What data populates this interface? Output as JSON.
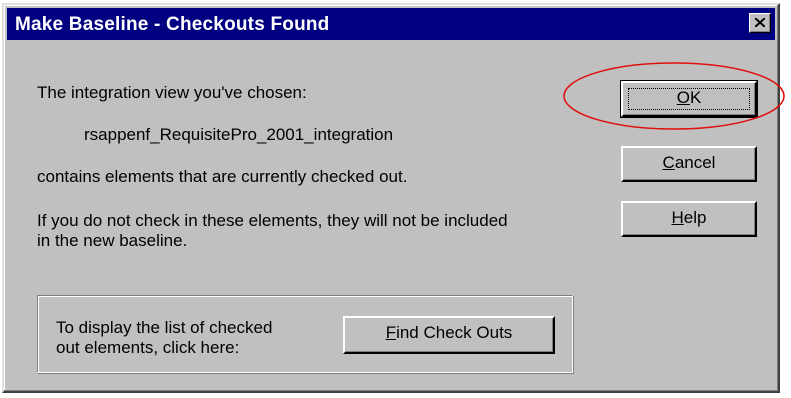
{
  "window": {
    "title": "Make Baseline - Checkouts Found",
    "close_label": "×"
  },
  "message": {
    "intro": "The integration view you've chosen:",
    "view_name": "rsappenf_RequisitePro_2001_integration",
    "contains": "contains elements that are currently checked out.",
    "warning_line1": "If you do not check in these elements, they will not be included",
    "warning_line2": "in the new baseline."
  },
  "buttons": {
    "ok": {
      "mnemonic": "O",
      "rest": "K"
    },
    "cancel": {
      "mnemonic": "C",
      "rest": "ancel"
    },
    "help": {
      "mnemonic": "H",
      "rest": "elp"
    }
  },
  "find_group": {
    "line1": "To display the list of checked",
    "line2": "out elements, click here:",
    "button": {
      "mnemonic": "F",
      "rest": "ind Check Outs"
    }
  },
  "colors": {
    "titlebar": "#000080",
    "dialog_face": "#c0c0c0",
    "annotation": "#e01010"
  }
}
